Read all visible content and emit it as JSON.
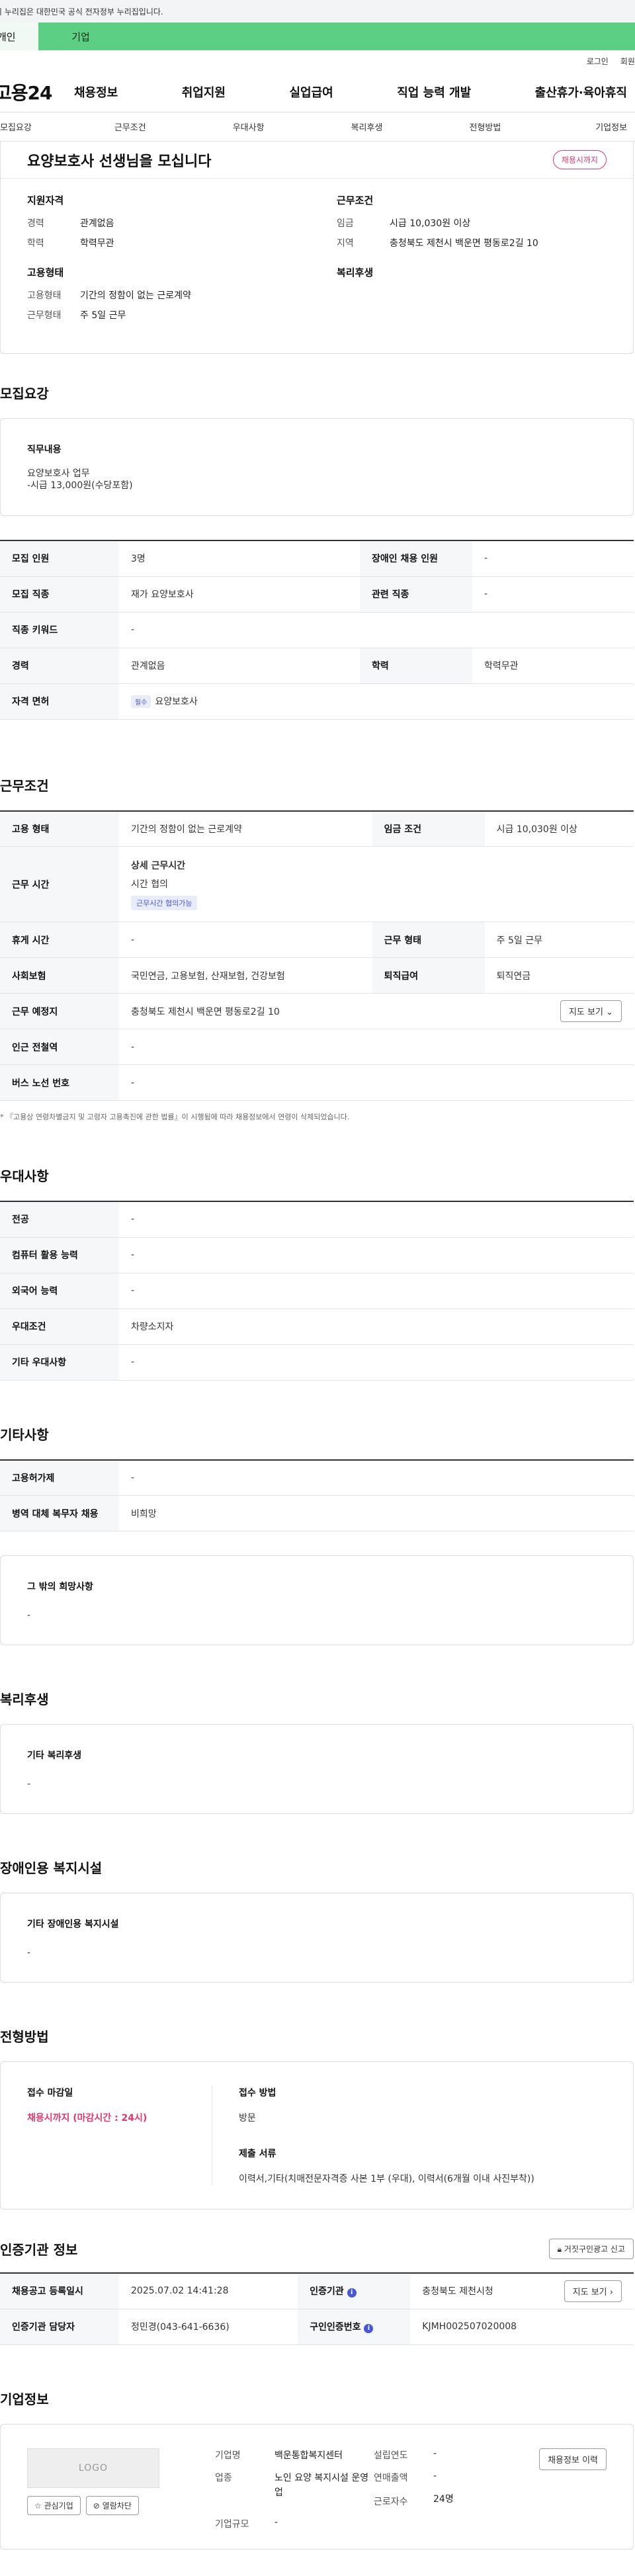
{
  "gov_banner": "이 누리집은 대한민국 공식 전자정부 누리집입니다.",
  "tabs": [
    "개인",
    "기업"
  ],
  "util": [
    "로그인",
    "회원가입"
  ],
  "gnb": {
    "logo": "고용24",
    "menu": [
      "채용정보",
      "취업지원",
      "실업급여",
      "직업 능력 개발",
      "출산휴가·육아휴직"
    ]
  },
  "subnav": [
    "모집요강",
    "근무조건",
    "우대사항",
    "복리후생",
    "전형방법",
    "기업정보"
  ],
  "summary": {
    "title": "요양보호사 선생님을 모십니다",
    "status": "채용시까지",
    "qual_title": "지원자격",
    "qual": [
      {
        "k": "경력",
        "v": "관계없음"
      },
      {
        "k": "학력",
        "v": "학력무관"
      }
    ],
    "cond_title": "근무조건",
    "cond": [
      {
        "k": "임금",
        "v": "시급 10,030원 이상"
      },
      {
        "k": "지역",
        "v": "충청북도 제천시 백운면 평동로2길 10"
      }
    ],
    "emp_title": "고용형태",
    "emp": [
      {
        "k": "고용형태",
        "v": "기간의 정함이 없는 근로계약"
      },
      {
        "k": "근무형태",
        "v": "주 5일 근무"
      }
    ],
    "welfare_title": "복리후생"
  },
  "recruit": {
    "title": "모집요강",
    "duty_title": "직무내용",
    "duty_lines": [
      "요양보호사 업무",
      "-시급 13,000원(수당포함)"
    ],
    "rows": {
      "count_k": "모집 인원",
      "count_v": "3명",
      "disabled_k": "장애인 채용 인원",
      "disabled_v": "-",
      "job_k": "모집 직종",
      "job_v": "재가 요양보호사",
      "related_k": "관련 직종",
      "related_v": "-",
      "keyword_k": "직종 키워드",
      "keyword_v": "-",
      "career_k": "경력",
      "career_v": "관계없음",
      "edu_k": "학력",
      "edu_v": "학력무관",
      "license_k": "자격 면허",
      "license_chip": "필수",
      "license_v": "요양보호사"
    }
  },
  "work": {
    "title": "근무조건",
    "rows": {
      "emp_k": "고용 형태",
      "emp_v": "기간의 정함이 없는 근로계약",
      "wage_k": "임금 조건",
      "wage_v": "시급 10,030원 이상",
      "time_k": "근무 시간",
      "time_l1": "상세 근무시간",
      "time_l2": "시간 협의",
      "time_chip": "근무시간 협의가능",
      "rest_k": "휴게 시간",
      "rest_v": "-",
      "form_k": "근무 형태",
      "form_v": "주 5일 근무",
      "ins_k": "사회보험",
      "ins_v": "국민연금, 고용보험, 산재보험, 건강보험",
      "retire_k": "퇴직급여",
      "retire_v": "퇴직연금",
      "place_k": "근무 예정지",
      "place_v": "충청북도 제천시 백운면 평동로2길 10",
      "map_btn": "지도 보기",
      "subway_k": "인근 전철역",
      "subway_v": "-",
      "bus_k": "버스 노선 번호",
      "bus_v": "-"
    },
    "note": "* 『고용상 연령차별금지 및 고령자 고용촉진에 관한 법률』이 시행됨에 따라 채용정보에서 연령이 삭제되었습니다."
  },
  "pref": {
    "title": "우대사항",
    "rows": [
      {
        "k": "전공",
        "v": "-"
      },
      {
        "k": "컴퓨터 활용 능력",
        "v": "-"
      },
      {
        "k": "외국어 능력",
        "v": "-"
      },
      {
        "k": "우대조건",
        "v": "차량소지자"
      },
      {
        "k": "기타 우대사항",
        "v": "-"
      }
    ]
  },
  "etc": {
    "title": "기타사항",
    "rows": [
      {
        "k": "고용허가제",
        "v": "-"
      },
      {
        "k": "병역 대체 복무자 채용",
        "v": "비희망"
      }
    ],
    "other_title": "그 밖의 희망사항",
    "other_v": "-"
  },
  "welfare": {
    "title": "복리후생",
    "box_title": "기타 복리후생",
    "box_v": "-"
  },
  "disabled": {
    "title": "장애인용 복지시설",
    "box_title": "기타 장애인용 복지시설",
    "box_v": "-"
  },
  "selection": {
    "title": "전형방법",
    "deadline_k": "접수 마감일",
    "deadline_v": "채용시까지 (마감시간 : 24시)",
    "method_k": "접수 방법",
    "method_v": "방문",
    "docs_k": "제출 서류",
    "docs_v": "이력서,기타(치매전문자격증 사본 1부 (우대), 이력서(6개월 이내 사진부착))"
  },
  "auth": {
    "title": "인증기관 정보",
    "report": "거짓구인광고 신고",
    "reg_k": "채용공고 등록일시",
    "reg_v": "2025.07.02 14:41:28",
    "org_k": "인증기관",
    "org_v": "충청북도 제천시청",
    "map_btn": "지도 보기",
    "mgr_k": "인증기관 담당자",
    "mgr_v": "정민경(043-641-6636)",
    "no_k": "구인인증번호",
    "no_v": "KJMH002507020008"
  },
  "company": {
    "title": "기업정보",
    "logo": "LOGO",
    "fav_btn": "관심기업",
    "block_btn": "열람차단",
    "history_btn": "채용정보 이력",
    "name_k": "기업명",
    "name_v": "백운통합복지센터",
    "year_k": "설립연도",
    "year_v": "-",
    "ind_k": "업종",
    "ind_v": "노인 요양 복지시설 운영업",
    "sales_k": "연매출액",
    "sales_v": "-",
    "emp_k": "근로자수",
    "emp_v": "24명",
    "scale_k": "기업규모",
    "scale_v": "-"
  }
}
